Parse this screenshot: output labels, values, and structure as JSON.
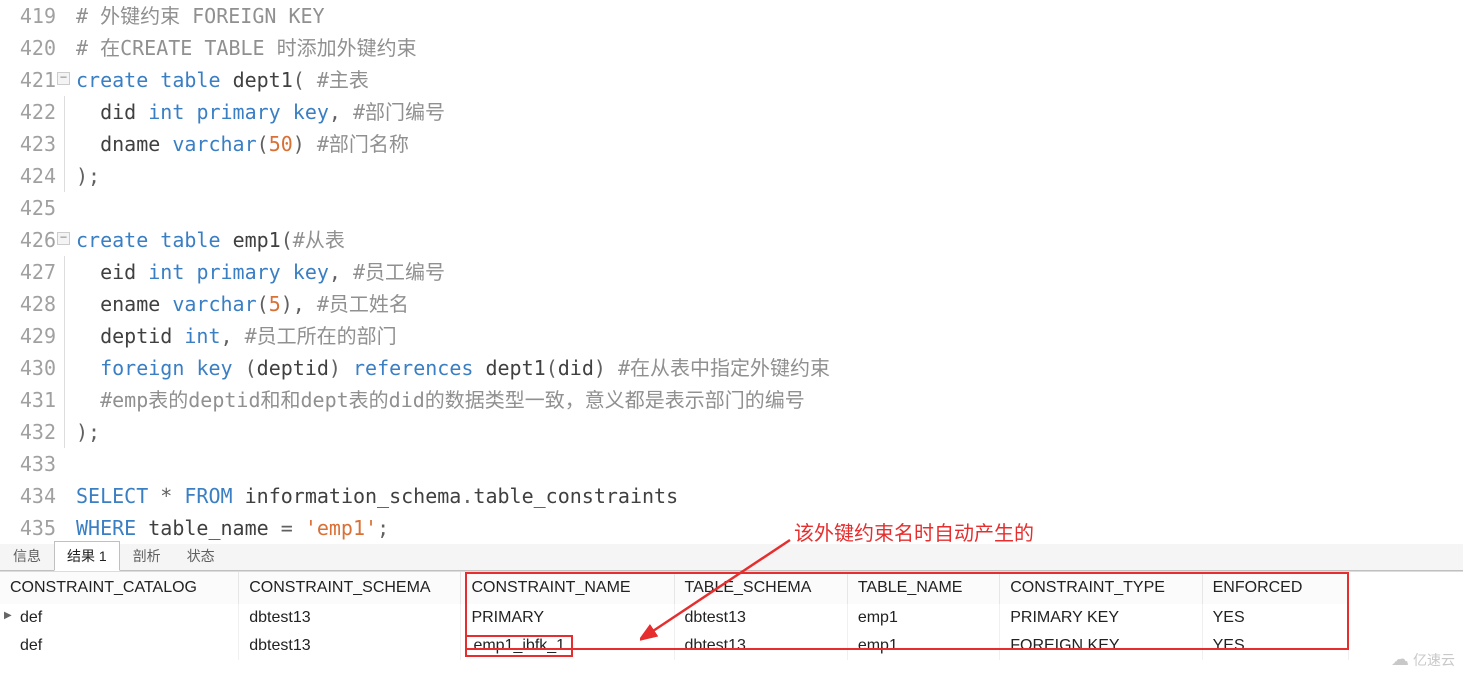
{
  "editor": {
    "lines": [
      {
        "n": 419,
        "fold": "",
        "tokens": [
          {
            "c": "cmt",
            "t": "#"
          },
          {
            "c": "cmt",
            "t": " 外键约束 "
          },
          {
            "c": "cmt",
            "t": "FOREIGN KEY"
          }
        ]
      },
      {
        "n": 420,
        "fold": "",
        "tokens": [
          {
            "c": "cmt",
            "t": "#"
          },
          {
            "c": "cmt",
            "t": " 在CREATE TABLE 时添加外键约束"
          }
        ]
      },
      {
        "n": 421,
        "fold": "open",
        "tokens": [
          {
            "c": "kw",
            "t": "create"
          },
          {
            "c": "",
            "t": " "
          },
          {
            "c": "kw",
            "t": "table"
          },
          {
            "c": "",
            "t": " "
          },
          {
            "c": "id",
            "t": "dept1"
          },
          {
            "c": "punc",
            "t": "("
          },
          {
            "c": "",
            "t": " "
          },
          {
            "c": "cmt",
            "t": "#主表"
          }
        ]
      },
      {
        "n": 422,
        "fold": "bar",
        "indent": "  ",
        "tokens": [
          {
            "c": "id",
            "t": "did "
          },
          {
            "c": "type",
            "t": "int"
          },
          {
            "c": "",
            "t": " "
          },
          {
            "c": "kw",
            "t": "primary"
          },
          {
            "c": "",
            "t": " "
          },
          {
            "c": "kw",
            "t": "key"
          },
          {
            "c": "punc",
            "t": ","
          },
          {
            "c": "",
            "t": " "
          },
          {
            "c": "cmt",
            "t": "#部门编号"
          }
        ]
      },
      {
        "n": 423,
        "fold": "bar",
        "indent": "  ",
        "tokens": [
          {
            "c": "id",
            "t": "dname "
          },
          {
            "c": "type",
            "t": "varchar"
          },
          {
            "c": "punc",
            "t": "("
          },
          {
            "c": "num",
            "t": "50"
          },
          {
            "c": "punc",
            "t": ")"
          },
          {
            "c": "",
            "t": " "
          },
          {
            "c": "cmt",
            "t": "#部门名称"
          }
        ]
      },
      {
        "n": 424,
        "fold": "bar",
        "tokens": [
          {
            "c": "punc",
            "t": ")"
          },
          {
            "c": "punc",
            "t": ";"
          }
        ]
      },
      {
        "n": 425,
        "fold": "",
        "tokens": []
      },
      {
        "n": 426,
        "fold": "open",
        "tokens": [
          {
            "c": "kw",
            "t": "create"
          },
          {
            "c": "",
            "t": " "
          },
          {
            "c": "kw",
            "t": "table"
          },
          {
            "c": "",
            "t": " "
          },
          {
            "c": "id",
            "t": "emp1"
          },
          {
            "c": "punc",
            "t": "("
          },
          {
            "c": "cmt",
            "t": "#从表"
          }
        ]
      },
      {
        "n": 427,
        "fold": "bar",
        "indent": "  ",
        "tokens": [
          {
            "c": "id",
            "t": "eid "
          },
          {
            "c": "type",
            "t": "int"
          },
          {
            "c": "",
            "t": " "
          },
          {
            "c": "kw",
            "t": "primary"
          },
          {
            "c": "",
            "t": " "
          },
          {
            "c": "kw",
            "t": "key"
          },
          {
            "c": "punc",
            "t": ","
          },
          {
            "c": "",
            "t": " "
          },
          {
            "c": "cmt",
            "t": "#员工编号"
          }
        ]
      },
      {
        "n": 428,
        "fold": "bar",
        "indent": "  ",
        "tokens": [
          {
            "c": "id",
            "t": "ename "
          },
          {
            "c": "type",
            "t": "varchar"
          },
          {
            "c": "punc",
            "t": "("
          },
          {
            "c": "num",
            "t": "5"
          },
          {
            "c": "punc",
            "t": ")"
          },
          {
            "c": "punc",
            "t": ","
          },
          {
            "c": "",
            "t": " "
          },
          {
            "c": "cmt",
            "t": "#员工姓名"
          }
        ]
      },
      {
        "n": 429,
        "fold": "bar",
        "indent": "  ",
        "tokens": [
          {
            "c": "id",
            "t": "deptid "
          },
          {
            "c": "type",
            "t": "int"
          },
          {
            "c": "punc",
            "t": ","
          },
          {
            "c": "",
            "t": " "
          },
          {
            "c": "cmt",
            "t": "#员工所在的部门"
          }
        ]
      },
      {
        "n": 430,
        "fold": "bar",
        "indent": "  ",
        "tokens": [
          {
            "c": "kw",
            "t": "foreign"
          },
          {
            "c": "",
            "t": " "
          },
          {
            "c": "kw",
            "t": "key"
          },
          {
            "c": "",
            "t": " "
          },
          {
            "c": "punc",
            "t": "("
          },
          {
            "c": "id",
            "t": "deptid"
          },
          {
            "c": "punc",
            "t": ")"
          },
          {
            "c": "",
            "t": " "
          },
          {
            "c": "kw",
            "t": "references"
          },
          {
            "c": "",
            "t": " "
          },
          {
            "c": "id",
            "t": "dept1"
          },
          {
            "c": "punc",
            "t": "("
          },
          {
            "c": "id",
            "t": "did"
          },
          {
            "c": "punc",
            "t": ")"
          },
          {
            "c": "",
            "t": " "
          },
          {
            "c": "cmt",
            "t": "#在从表中指定外键约束"
          }
        ]
      },
      {
        "n": 431,
        "fold": "bar",
        "indent": "  ",
        "tokens": [
          {
            "c": "cmt",
            "t": "#emp表的deptid和和dept表的did的数据类型一致，意义都是表示部门的编号"
          }
        ]
      },
      {
        "n": 432,
        "fold": "bar",
        "tokens": [
          {
            "c": "punc",
            "t": ")"
          },
          {
            "c": "punc",
            "t": ";"
          }
        ]
      },
      {
        "n": 433,
        "fold": "",
        "tokens": []
      },
      {
        "n": 434,
        "fold": "",
        "tokens": [
          {
            "c": "kw",
            "t": "SELECT"
          },
          {
            "c": "",
            "t": " "
          },
          {
            "c": "punc",
            "t": "*"
          },
          {
            "c": "",
            "t": " "
          },
          {
            "c": "kw",
            "t": "FROM"
          },
          {
            "c": "",
            "t": " "
          },
          {
            "c": "id",
            "t": "information_schema"
          },
          {
            "c": "punc",
            "t": "."
          },
          {
            "c": "id",
            "t": "table_constraints"
          }
        ]
      },
      {
        "n": 435,
        "fold": "",
        "tokens": [
          {
            "c": "kw",
            "t": "WHERE"
          },
          {
            "c": "",
            "t": " "
          },
          {
            "c": "id",
            "t": "table_name "
          },
          {
            "c": "punc",
            "t": "="
          },
          {
            "c": "",
            "t": " "
          },
          {
            "c": "str",
            "t": "'emp1'"
          },
          {
            "c": "punc",
            "t": ";"
          }
        ]
      }
    ]
  },
  "tabs": {
    "info": "信息",
    "result1": "结果 1",
    "profile": "剖析",
    "status": "状态"
  },
  "result": {
    "columns": [
      "CONSTRAINT_CATALOG",
      "CONSTRAINT_SCHEMA",
      "CONSTRAINT_NAME",
      "TABLE_SCHEMA",
      "TABLE_NAME",
      "CONSTRAINT_TYPE",
      "ENFORCED"
    ],
    "rows": [
      {
        "selected": true,
        "cells": [
          "def",
          "dbtest13",
          "PRIMARY",
          "dbtest13",
          "emp1",
          "PRIMARY KEY",
          "YES"
        ]
      },
      {
        "selected": false,
        "cells": [
          "def",
          "dbtest13",
          "emp1_ibfk_1",
          "dbtest13",
          "emp1",
          "FOREIGN KEY",
          "YES"
        ],
        "highlightCol": 2
      }
    ]
  },
  "annotation": {
    "text": "该外键约束名时自动产生的"
  },
  "watermark": {
    "text": "亿速云"
  }
}
